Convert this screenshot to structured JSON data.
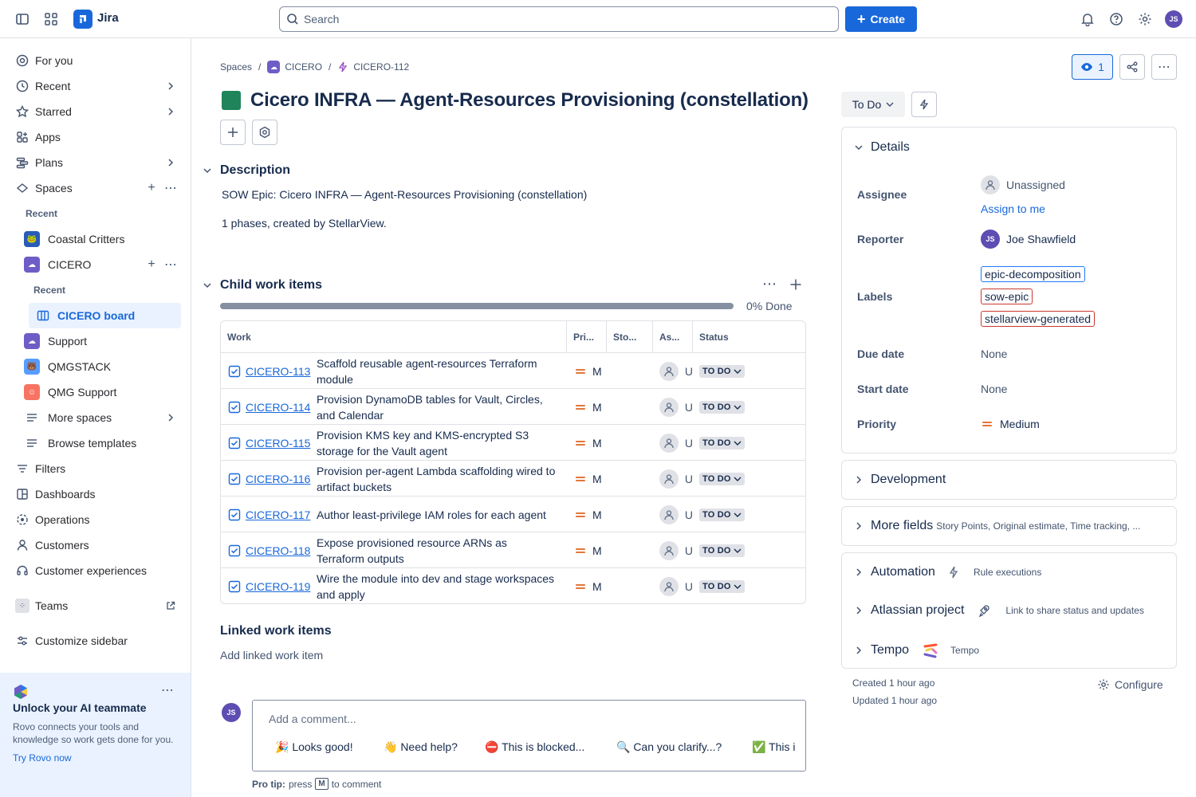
{
  "app": {
    "name": "Jira"
  },
  "topbar": {
    "search_placeholder": "Search",
    "create_label": "Create",
    "user_initials": "JS"
  },
  "sidebar": {
    "items": {
      "for_you": "For you",
      "recent": "Recent",
      "starred": "Starred",
      "apps": "Apps",
      "plans": "Plans",
      "spaces": "Spaces",
      "recent_sub": "Recent",
      "coastal": "Coastal Critters",
      "cicero": "CICERO",
      "recent_sub2": "Recent",
      "cicero_board": "CICERO board",
      "support": "Support",
      "qmgstack": "QMGSTACK",
      "qmg_support": "QMG Support",
      "more_spaces": "More spaces",
      "browse_templates": "Browse templates",
      "filters": "Filters",
      "dashboards": "Dashboards",
      "operations": "Operations",
      "customers": "Customers",
      "customer_experiences": "Customer experiences",
      "teams": "Teams",
      "customize": "Customize sidebar"
    },
    "rovo": {
      "title": "Unlock your AI teammate",
      "body": "Rovo connects your tools and knowledge so work gets done for you.",
      "link": "Try Rovo now"
    }
  },
  "breadcrumb": {
    "spaces": "Spaces",
    "project": "CICERO",
    "issue": "CICERO-112"
  },
  "issue": {
    "title": "Cicero INFRA — Agent-Resources Provisioning (constellation)",
    "description_heading": "Description",
    "description_line1": "SOW Epic: Cicero INFRA — Agent-Resources Provisioning (constellation)",
    "description_line2": "1 phases, created by StellarView.",
    "epic_color": "#1f845a"
  },
  "child_items": {
    "heading": "Child work items",
    "progress_label": "0% Done",
    "progress_fraction": 0,
    "columns": {
      "work": "Work",
      "priority": "Pri...",
      "story": "Sto...",
      "assignee": "As...",
      "status": "Status"
    },
    "rows": [
      {
        "key": "CICERO-113",
        "summary": "Scaffold reusable agent-resources Terraform module",
        "priority": "M",
        "assignee": "U",
        "status": "TO DO"
      },
      {
        "key": "CICERO-114",
        "summary": "Provision DynamoDB tables for Vault, Circles, and Calendar",
        "priority": "M",
        "assignee": "U",
        "status": "TO DO"
      },
      {
        "key": "CICERO-115",
        "summary": "Provision KMS key and KMS-encrypted S3 storage for the Vault agent",
        "priority": "M",
        "assignee": "U",
        "status": "TO DO"
      },
      {
        "key": "CICERO-116",
        "summary": "Provision per-agent Lambda scaffolding wired to artifact buckets",
        "priority": "M",
        "assignee": "U",
        "status": "TO DO"
      },
      {
        "key": "CICERO-117",
        "summary": "Author least-privilege IAM roles for each agent",
        "priority": "M",
        "assignee": "U",
        "status": "TO DO"
      },
      {
        "key": "CICERO-118",
        "summary": "Expose provisioned resource ARNs as Terraform outputs",
        "priority": "M",
        "assignee": "U",
        "status": "TO DO"
      },
      {
        "key": "CICERO-119",
        "summary": "Wire the module into dev and stage workspaces and apply",
        "priority": "M",
        "assignee": "U",
        "status": "TO DO"
      }
    ]
  },
  "linked": {
    "heading": "Linked work items",
    "add": "Add linked work item"
  },
  "comment": {
    "placeholder": "Add a comment...",
    "chips": [
      "🎉 Looks good!",
      "👋 Need help?",
      "⛔ This is blocked...",
      "🔍 Can you clarify...?",
      "✅ This i"
    ],
    "protip_label": "Pro tip:",
    "protip_press": "press",
    "protip_key": "M",
    "protip_rest": "to comment",
    "user_initials": "JS"
  },
  "right": {
    "watch_count": "1",
    "status": "To Do",
    "details": {
      "heading": "Details",
      "assignee_label": "Assignee",
      "assignee_value": "Unassigned",
      "assign_to_me": "Assign to me",
      "reporter_label": "Reporter",
      "reporter_value": "Joe Shawfield",
      "reporter_initials": "JS",
      "labels_label": "Labels",
      "labels": [
        {
          "text": "epic-decomposition",
          "color": "#1d7afc"
        },
        {
          "text": "sow-epic",
          "color": "#c9372c"
        },
        {
          "text": "stellarview-generated",
          "color": "#c9372c"
        }
      ],
      "due_label": "Due date",
      "due_value": "None",
      "start_label": "Start date",
      "start_value": "None",
      "priority_label": "Priority",
      "priority_value": "Medium"
    },
    "development": "Development",
    "more_fields": "More fields",
    "more_fields_hint": "Story Points, Original estimate, Time tracking, ...",
    "automation": "Automation",
    "automation_hint": "Rule executions",
    "atlassian": "Atlassian project",
    "atlassian_hint": "Link to share status and updates",
    "tempo": "Tempo",
    "tempo_hint": "Tempo",
    "created": "Created 1 hour ago",
    "updated": "Updated 1 hour ago",
    "configure": "Configure"
  }
}
